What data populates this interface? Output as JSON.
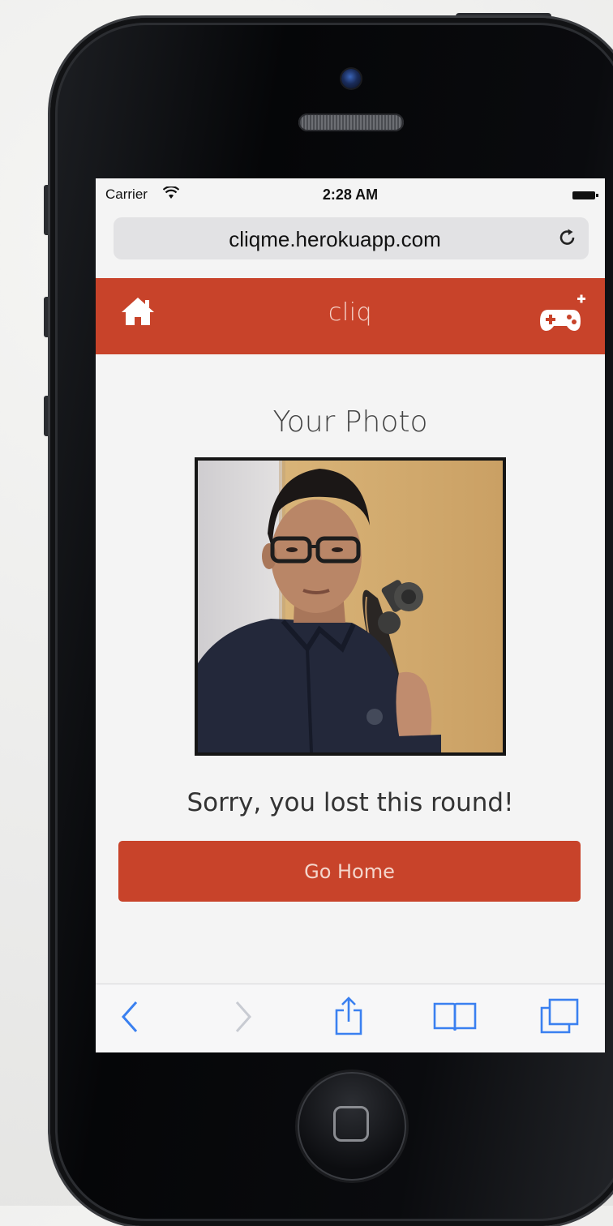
{
  "status_bar": {
    "carrier": "Carrier",
    "time": "2:28 AM"
  },
  "browser": {
    "url": "cliqme.herokuapp.com"
  },
  "app_header": {
    "title": "cliq",
    "home_icon": "home-icon",
    "add_game_icon": "gamepad-plus-icon"
  },
  "main": {
    "heading": "Your Photo",
    "result_message": "Sorry, you lost this round!",
    "go_home_label": "Go Home"
  },
  "toolbar": {
    "icons": [
      "back-icon",
      "forward-icon",
      "share-icon",
      "bookmarks-icon",
      "tabs-icon"
    ]
  },
  "colors": {
    "accent": "#c8432a",
    "safari_blue": "#3a80f0"
  }
}
